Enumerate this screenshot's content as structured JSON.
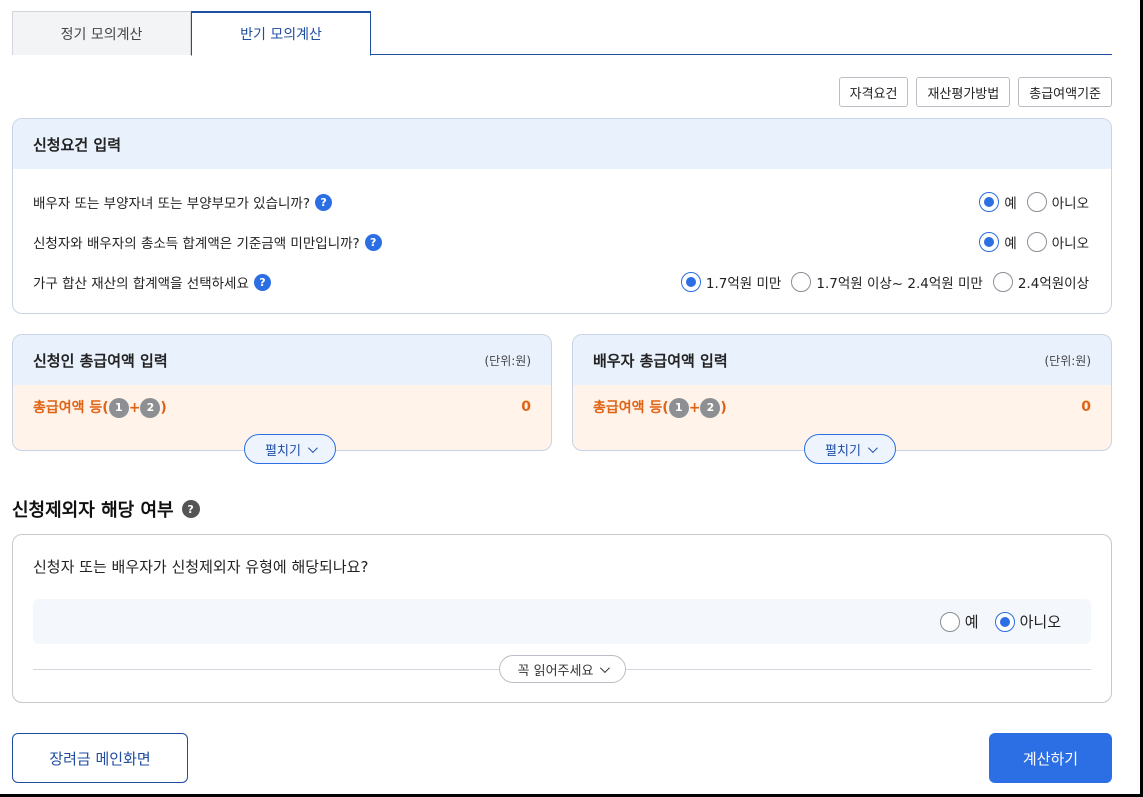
{
  "tabs": [
    {
      "label": "정기 모의계산",
      "active": false
    },
    {
      "label": "반기 모의계산",
      "active": true
    }
  ],
  "top_buttons": [
    "자격요건",
    "재산평가방법",
    "총급여액기준"
  ],
  "requirements": {
    "title": "신청요건 입력",
    "questions": [
      {
        "text": "배우자 또는 부양자녀 또는 부양부모가 있습니까?",
        "options": [
          "예",
          "아니오"
        ],
        "selected": "예"
      },
      {
        "text": "신청자와 배우자의 총소득 합계액은 기준금액 미만입니까?",
        "options": [
          "예",
          "아니오"
        ],
        "selected": "예"
      },
      {
        "text": "가구 합산 재산의 합계액을 선택하세요",
        "options": [
          "1.7억원 미만",
          "1.7억원 이상~ 2.4억원 미만",
          "2.4억원이상"
        ],
        "selected": "1.7억원 미만"
      }
    ]
  },
  "applicant_income": {
    "title": "신청인 총급여액 입력",
    "unit": "(단위:원)",
    "row_label": "총급여액 등(",
    "badge1": "1",
    "plus": "+",
    "badge2": "2",
    "close": ")",
    "value": "0",
    "expand_label": "펼치기"
  },
  "spouse_income": {
    "title": "배우자 총급여액 입력",
    "unit": "(단위:원)",
    "row_label": "총급여액 등(",
    "badge1": "1",
    "plus": "+",
    "badge2": "2",
    "close": ")",
    "value": "0",
    "expand_label": "펼치기"
  },
  "exclusion": {
    "section_title": "신청제외자 해당 여부",
    "question": "신청자 또는 배우자가 신청제외자 유형에 해당되나요?",
    "options": [
      "예",
      "아니오"
    ],
    "selected": "아니오",
    "read_more_label": "꼭 읽어주세요"
  },
  "footer": {
    "main_button": "장려금 메인화면",
    "calc_button": "계산하기"
  },
  "colors": {
    "accent": "#2c6ee3",
    "navy": "#1f4ea1",
    "orange": "#e06416",
    "panel_header_bg": "#e9f1fd",
    "income_bg": "#fff3ea"
  }
}
